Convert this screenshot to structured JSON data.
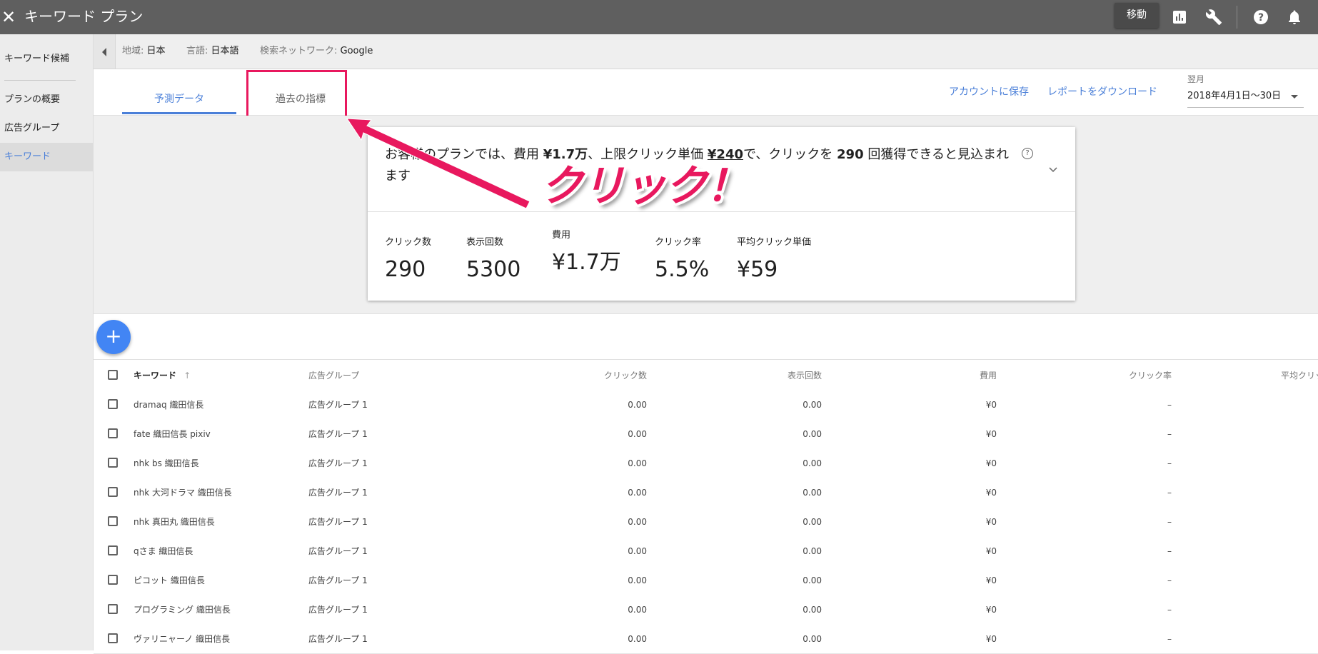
{
  "topbar": {
    "close_icon": "close-icon",
    "title": "キーワード プラン",
    "move_label": "移動",
    "icons": [
      "reports-icon",
      "tools-wrench-icon",
      "help-icon",
      "notifications-bell-icon"
    ]
  },
  "sidebar": {
    "items": [
      {
        "label": "キーワード候補"
      },
      {
        "label": "プランの概要"
      },
      {
        "label": "広告グループ"
      },
      {
        "label": "キーワード",
        "active": true
      }
    ]
  },
  "filters": {
    "region_label": "地域:",
    "region_value": "日本",
    "language_label": "言語:",
    "language_value": "日本語",
    "network_label": "検索ネットワーク:",
    "network_value": "Google"
  },
  "tabs": {
    "forecast": "予測データ",
    "historical": "過去の指標"
  },
  "actions": {
    "save": "アカウントに保存",
    "download": "レポートをダウンロード"
  },
  "date_range": {
    "label": "翌月",
    "value": "2018年4月1日～30日"
  },
  "summary": {
    "p1": "お客様のプランでは、費用 ",
    "cost": "¥1.7万",
    "p2": "、上限クリック単価 ",
    "max_cpc": "¥240",
    "p3": "で、クリックを ",
    "clicks": "290",
    "p4": " 回獲得できると見込まれます",
    "help": "?"
  },
  "metrics": [
    {
      "label": "クリック数",
      "value": "290"
    },
    {
      "label": "表示回数",
      "value": "5300"
    },
    {
      "label": "費用",
      "value": "¥1.7万"
    },
    {
      "label": "クリック率",
      "value": "5.5%"
    },
    {
      "label": "平均クリック単価",
      "value": "¥59"
    }
  ],
  "add_button": "+",
  "table": {
    "headers": {
      "keyword": "キーワード",
      "sort_arrow": "↑",
      "ad_group": "広告グループ",
      "clicks": "クリック数",
      "impressions": "表示回数",
      "cost": "費用",
      "ctr": "クリック率",
      "avg_cpc": "平均クリッ"
    },
    "rows": [
      {
        "keyword": "dramaq 織田信長",
        "ad_group": "広告グループ 1",
        "clicks": "0.00",
        "impressions": "0.00",
        "cost": "¥0",
        "ctr": "–"
      },
      {
        "keyword": "fate 織田信長 pixiv",
        "ad_group": "広告グループ 1",
        "clicks": "0.00",
        "impressions": "0.00",
        "cost": "¥0",
        "ctr": "–"
      },
      {
        "keyword": "nhk bs 織田信長",
        "ad_group": "広告グループ 1",
        "clicks": "0.00",
        "impressions": "0.00",
        "cost": "¥0",
        "ctr": "–"
      },
      {
        "keyword": "nhk 大河ドラマ 織田信長",
        "ad_group": "広告グループ 1",
        "clicks": "0.00",
        "impressions": "0.00",
        "cost": "¥0",
        "ctr": "–"
      },
      {
        "keyword": "nhk 真田丸 織田信長",
        "ad_group": "広告グループ 1",
        "clicks": "0.00",
        "impressions": "0.00",
        "cost": "¥0",
        "ctr": "–"
      },
      {
        "keyword": "qさま 織田信長",
        "ad_group": "広告グループ 1",
        "clicks": "0.00",
        "impressions": "0.00",
        "cost": "¥0",
        "ctr": "–"
      },
      {
        "keyword": "ピコット 織田信長",
        "ad_group": "広告グループ 1",
        "clicks": "0.00",
        "impressions": "0.00",
        "cost": "¥0",
        "ctr": "–"
      },
      {
        "keyword": "プログラミング 織田信長",
        "ad_group": "広告グループ 1",
        "clicks": "0.00",
        "impressions": "0.00",
        "cost": "¥0",
        "ctr": "–"
      },
      {
        "keyword": "ヴァリニャーノ 織田信長",
        "ad_group": "広告グループ 1",
        "clicks": "0.00",
        "impressions": "0.00",
        "cost": "¥0",
        "ctr": "–"
      }
    ]
  },
  "annotation": {
    "text": "クリック！",
    "color": "#e8185e"
  }
}
